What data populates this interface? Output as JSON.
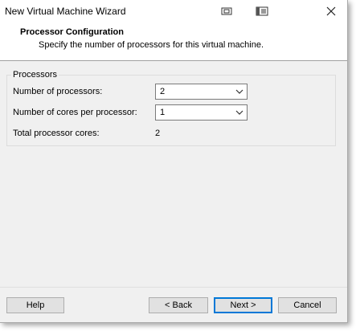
{
  "window": {
    "title": "New Virtual Machine Wizard"
  },
  "header": {
    "title": "Processor Configuration",
    "subtitle": "Specify the number of processors for this virtual machine."
  },
  "processors": {
    "group_label": "Processors",
    "num_processors_label": "Number of processors:",
    "num_processors_value": "2",
    "cores_label": "Number of cores per processor:",
    "cores_value": "1",
    "total_label": "Total processor cores:",
    "total_value": "2"
  },
  "buttons": {
    "help": "Help",
    "back": "< Back",
    "next": "Next >",
    "cancel": "Cancel"
  },
  "colors": {
    "accent": "#0078d7"
  }
}
